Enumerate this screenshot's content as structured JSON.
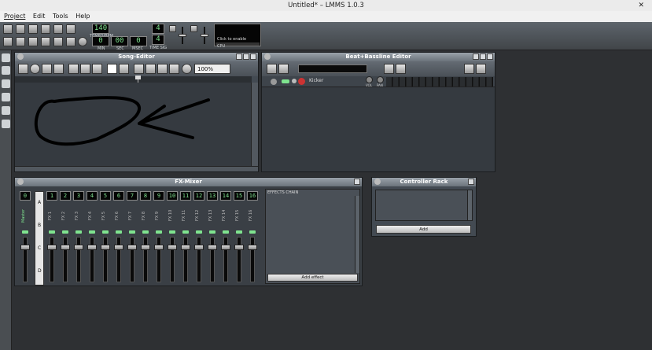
{
  "window": {
    "title": "Untitled* – LMMS 1.0.3",
    "close": "✕"
  },
  "menu": [
    "Project",
    "Edit",
    "Tools",
    "Help"
  ],
  "toolbar": {
    "tempo": "140",
    "tempo_label": "TEMPO/BPM",
    "time_min": "0",
    "time_sec": "00",
    "time_msec": "0",
    "min_label": "MIN",
    "sec_label": "SEC",
    "msec_label": "MSEC",
    "sig_num": "4",
    "sig_den": "4",
    "sig_label": "TIME SIG",
    "cpu_text": "Click to enable",
    "cpu_label": "CPU"
  },
  "song_editor": {
    "title": "Song-Editor",
    "zoom": "100%"
  },
  "bb_editor": {
    "title": "Beat+Bassline Editor",
    "track": "Kicker",
    "vol_label": "VOL",
    "pan_label": "PAN"
  },
  "fx_mixer": {
    "title": "FX-Mixer",
    "master_num": "0",
    "master_label": "Master",
    "channels": [
      {
        "num": "1",
        "label": "FX 1"
      },
      {
        "num": "2",
        "label": "FX 2"
      },
      {
        "num": "3",
        "label": "FX 3"
      },
      {
        "num": "4",
        "label": "FX 4"
      },
      {
        "num": "5",
        "label": "FX 5"
      },
      {
        "num": "6",
        "label": "FX 6"
      },
      {
        "num": "7",
        "label": "FX 7"
      },
      {
        "num": "8",
        "label": "FX 8"
      },
      {
        "num": "9",
        "label": "FX 9"
      },
      {
        "num": "10",
        "label": "FX 10"
      },
      {
        "num": "11",
        "label": "FX 11"
      },
      {
        "num": "12",
        "label": "FX 12"
      },
      {
        "num": "13",
        "label": "FX 13"
      },
      {
        "num": "14",
        "label": "FX 14"
      },
      {
        "num": "15",
        "label": "FX 15"
      },
      {
        "num": "16",
        "label": "FX 16"
      }
    ],
    "banks": [
      "A",
      "B",
      "C",
      "D"
    ],
    "effects_chain": "EFFECTS CHAIN",
    "add_effect": "Add effect"
  },
  "controller_rack": {
    "title": "Controller Rack",
    "add": "Add"
  }
}
